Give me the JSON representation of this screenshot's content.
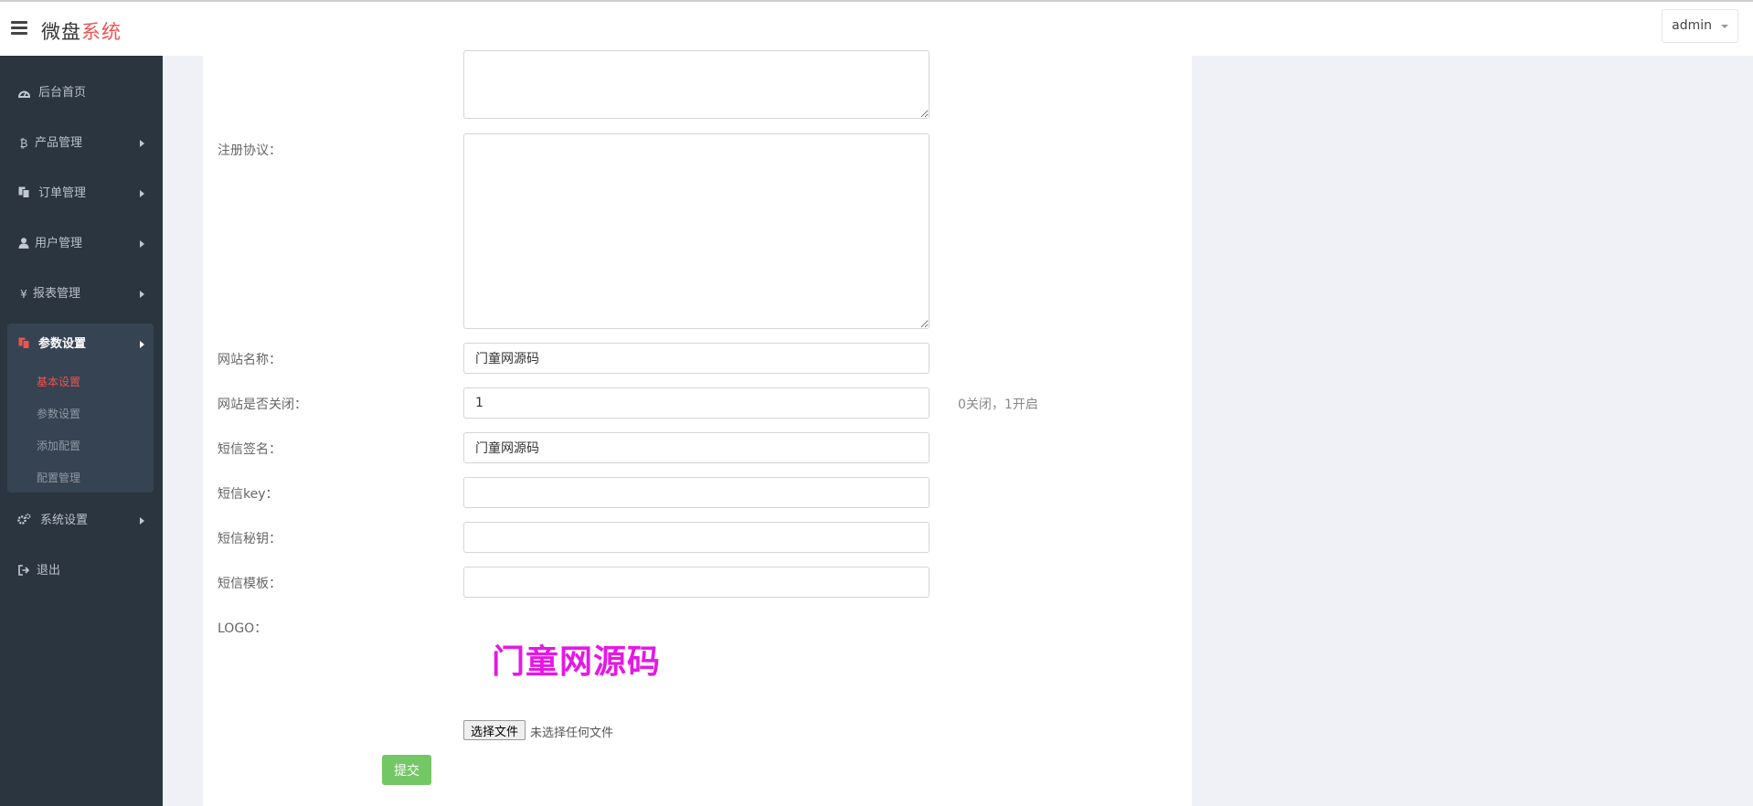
{
  "header": {
    "brand_main": "微盘",
    "brand_accent": "系统",
    "user_name": "admin"
  },
  "sidebar": {
    "items": [
      {
        "label": "后台首页",
        "icon": "dashboard-icon"
      },
      {
        "label": "产品管理",
        "icon": "bitcoin-icon"
      },
      {
        "label": "订单管理",
        "icon": "copy-icon"
      },
      {
        "label": "用户管理",
        "icon": "user-icon"
      },
      {
        "label": "报表管理",
        "icon": "yen-icon"
      },
      {
        "label": "参数设置",
        "icon": "copy-icon"
      },
      {
        "label": "系统设置",
        "icon": "gears-icon"
      },
      {
        "label": "退出",
        "icon": "sign-out-icon"
      }
    ],
    "sub_items": [
      "基本设置",
      "参数设置",
      "添加配置",
      "配置管理"
    ],
    "icons": {
      "bitcoin": "₿",
      "yen": "¥"
    }
  },
  "form": {
    "register_agreement_label": "注册协议：",
    "site_name_label": "网站名称：",
    "site_name_value": "门童网源码",
    "site_closed_label": "网站是否关闭：",
    "site_closed_value": "1",
    "site_closed_hint": "0关闭，1开启",
    "sms_signature_label": "短信签名：",
    "sms_signature_value": "门童网源码",
    "sms_key_label": "短信key：",
    "sms_key_value": "",
    "sms_secret_label": "短信秘钥：",
    "sms_secret_value": "",
    "sms_template_label": "短信模板：",
    "sms_template_value": "",
    "logo_label": "LOGO：",
    "logo_text": "门童网源码",
    "file_button": "选择文件",
    "file_status": "未选择任何文件",
    "submit": "提交"
  },
  "colors": {
    "accent": "#ef5350",
    "sidebar_bg": "#2b3540",
    "submit_green": "#74c765",
    "logo_magenta": "#e617e6"
  }
}
